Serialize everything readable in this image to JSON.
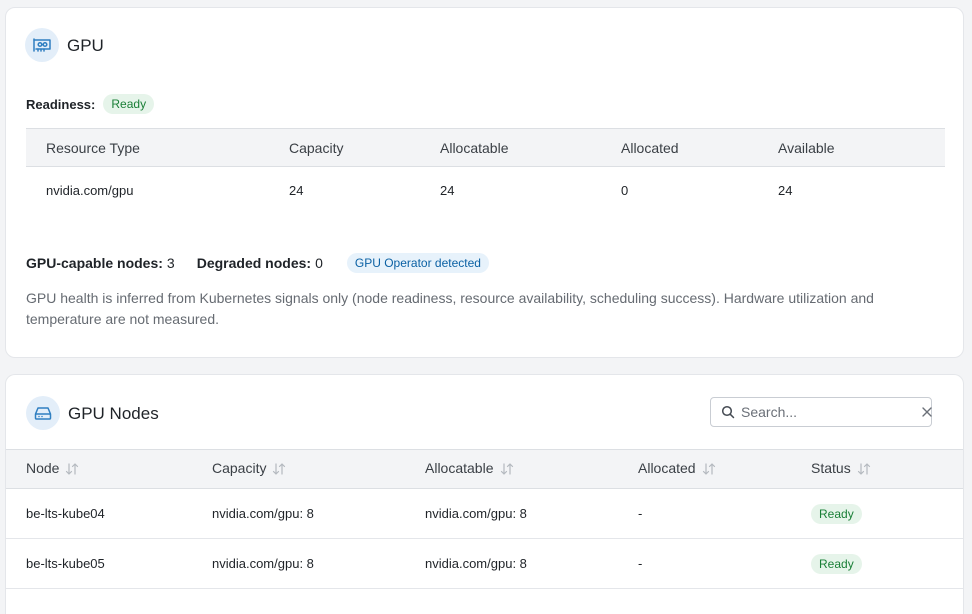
{
  "gpu_card": {
    "title": "GPU",
    "readiness_label": "Readiness:",
    "readiness_value": "Ready",
    "resource_table": {
      "headers": [
        "Resource Type",
        "Capacity",
        "Allocatable",
        "Allocated",
        "Available"
      ],
      "rows": [
        [
          "nvidia.com/gpu",
          "24",
          "24",
          "0",
          "24"
        ]
      ]
    },
    "gpu_capable_label": "GPU-capable nodes:",
    "gpu_capable_value": "3",
    "degraded_label": "Degraded nodes:",
    "degraded_value": "0",
    "operator_badge": "GPU Operator detected",
    "health_note": "GPU health is inferred from Kubernetes signals only (node readiness, resource availability, scheduling success). Hardware utilization and temperature are not measured."
  },
  "nodes_card": {
    "title": "GPU Nodes",
    "search": {
      "placeholder": "Search...",
      "value": ""
    },
    "table": {
      "headers": [
        "Node",
        "Capacity",
        "Allocatable",
        "Allocated",
        "Status"
      ],
      "rows": [
        [
          "be-lts-kube04",
          "nvidia.com/gpu: 8",
          "nvidia.com/gpu: 8",
          "-",
          "Ready"
        ],
        [
          "be-lts-kube05",
          "nvidia.com/gpu: 8",
          "nvidia.com/gpu: 8",
          "-",
          "Ready"
        ]
      ]
    }
  },
  "colors": {
    "accent_icon_bg": "#e3eef9",
    "accent_icon": "#2f7fc1",
    "ready_bg": "#e6f4ea",
    "ready_text": "#1a7f37",
    "operator_bg": "#e7f2fb",
    "operator_text": "#0b61a4"
  },
  "icons": {
    "gpu_card": "gpu-card-icon",
    "nodes_card": "hard-drive-icon",
    "search": "search-icon",
    "clear": "close-icon",
    "sort": "sort-arrows-icon"
  }
}
